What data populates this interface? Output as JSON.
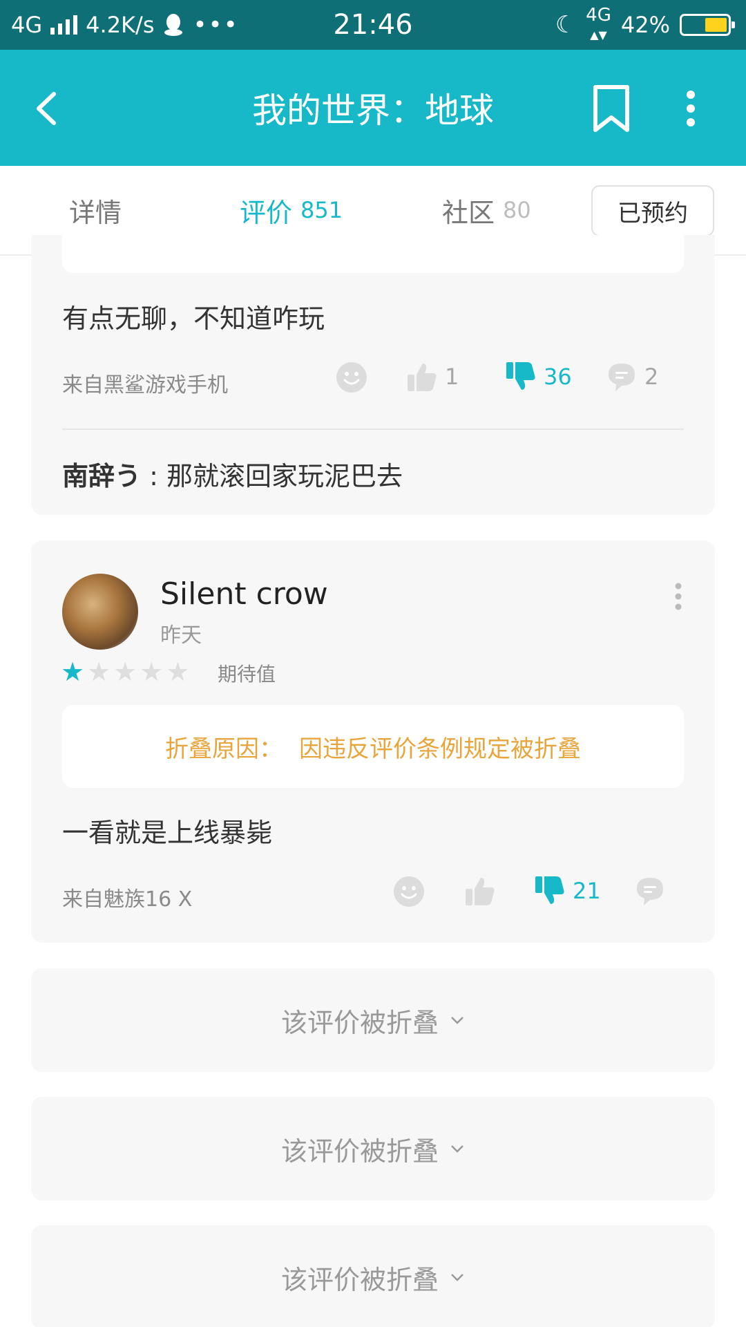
{
  "status_bar": {
    "network": "4G",
    "speed": "4.2K/s",
    "time": "21:46",
    "net_gen": "4G",
    "battery": "42%"
  },
  "app_bar": {
    "title": "我的世界：地球"
  },
  "tabs": [
    {
      "label": "详情",
      "count": ""
    },
    {
      "label": "评价",
      "count": "851"
    },
    {
      "label": "社区",
      "count": "80"
    }
  ],
  "reserve_button": "已预约",
  "review1": {
    "text": "有点无聊，不知道咋玩",
    "device": "来自黑鲨游戏手机",
    "likes": "1",
    "dislikes": "36",
    "comments": "2",
    "reply": {
      "author": "南辞う",
      "separator": " : ",
      "text": "那就滚回家玩泥巴去"
    }
  },
  "review2": {
    "username": "Silent crow",
    "date": "昨天",
    "rating": 1,
    "rating_label": "期待值",
    "fold_reason_label": "折叠原因：",
    "fold_reason_text": "因违反评价条例规定被折叠",
    "text": "一看就是上线暴毙",
    "device": "来自魅族16 X",
    "dislikes": "21"
  },
  "folded_reviews": [
    {
      "label": "该评价被折叠"
    },
    {
      "label": "该评价被折叠"
    },
    {
      "label": "该评价被折叠"
    }
  ],
  "colors": {
    "accent": "#17b9c9",
    "status_bar": "#0f6f77",
    "fold_reason": "#e8a53c"
  }
}
